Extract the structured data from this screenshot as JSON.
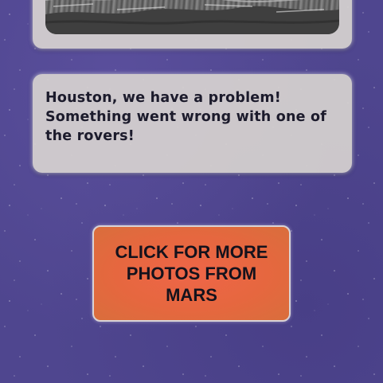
{
  "photo_card": {
    "image_name": "mars-rover-photo"
  },
  "message": {
    "text": "Houston, we have a problem! Something went wrong with one of the rovers!"
  },
  "cta": {
    "label": "CLICK FOR MORE PHOTOS FROM MARS"
  },
  "colors": {
    "background": "#4f468f",
    "card": "#d6d2d0",
    "button": "#e6673f",
    "text": "#1c1b2c"
  }
}
